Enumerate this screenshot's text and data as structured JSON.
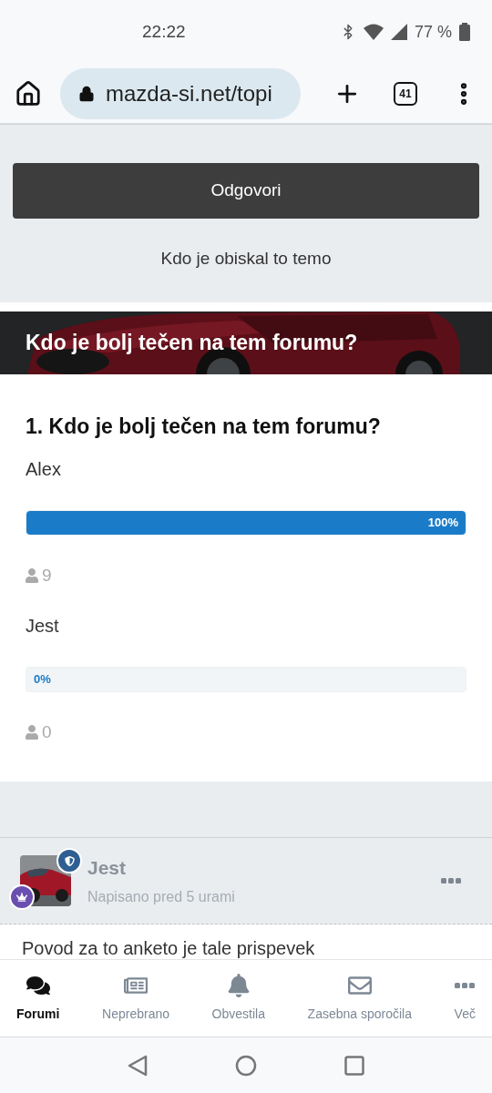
{
  "status_bar": {
    "time": "22:22",
    "battery": "77 %"
  },
  "browser": {
    "url": "mazda-si.net/topi",
    "tab_count": "41"
  },
  "reply_button": "Odgovori",
  "visitors_link": "Kdo je obiskal to temo",
  "poll": {
    "banner_title": "Kdo je bolj tečen na tem forumu?",
    "question": "1. Kdo je bolj tečen na tem forumu?",
    "options": [
      {
        "label": "Alex",
        "level": 1,
        "percent": "100%",
        "votes": "9"
      },
      {
        "label": "Jest",
        "level": 0,
        "percent": "0%",
        "votes": "0"
      }
    ]
  },
  "post": {
    "author": "Jest",
    "meta": "Napisano pred 5 urami",
    "body": "Povod za to anketo je tale prispevek"
  },
  "bottom_nav": [
    {
      "kind": "comments",
      "label": "Forumi",
      "selected": true
    },
    {
      "kind": "newspaper",
      "label": "Neprebrano",
      "selected": false
    },
    {
      "kind": "bell",
      "label": "Obvestila",
      "selected": false
    },
    {
      "kind": "envelope",
      "label": "Zasebna sporočila",
      "selected": false
    },
    {
      "kind": "more",
      "label": "Več",
      "selected": false
    }
  ]
}
